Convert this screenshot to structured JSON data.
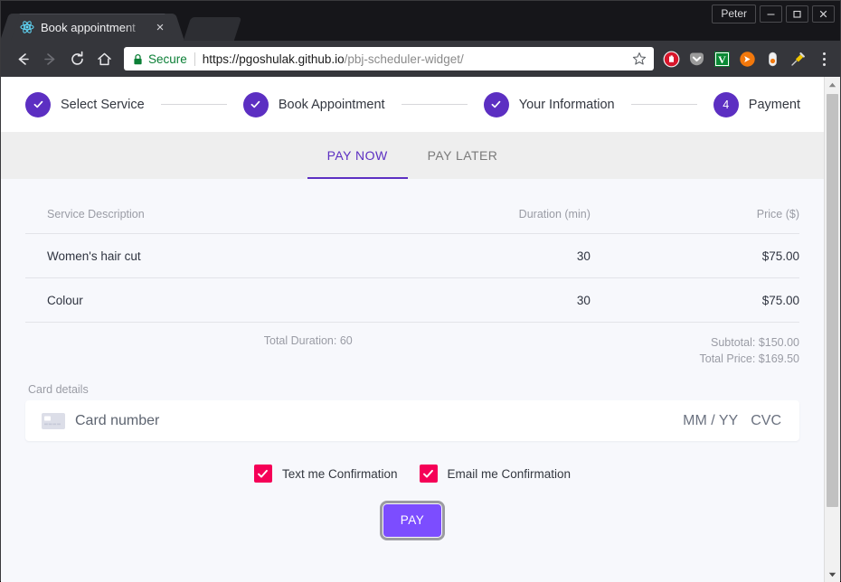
{
  "browser": {
    "window_user": "Peter",
    "minimize_label": "Minimize",
    "maximize_label": "Maximize",
    "close_label": "Close",
    "tab": {
      "title": "Book appointment",
      "favicon_name": "react-atom-favicon",
      "close_label": "×"
    },
    "new_tab_label": "New tab",
    "nav": {
      "back_label": "Back",
      "forward_label": "Forward",
      "reload_label": "Reload",
      "home_label": "Home"
    },
    "omnibox": {
      "security_text": "Secure",
      "url_domain": "https://pgoshulak.github.io",
      "url_path": "/pbj-scheduler-widget/",
      "bookmark_label": "Bookmark this page"
    },
    "extensions": [
      "adblock-icon",
      "pocket-icon",
      "vimeo-icon",
      "orange-arrow-icon",
      "capsule-icon",
      "syringe-icon"
    ],
    "menu_label": "Customize and control"
  },
  "colors": {
    "primary_purple": "#5c2fc2",
    "pay_button_purple": "#7c4dff",
    "checkbox_pink": "#f50057",
    "page_background": "#f7f8fc",
    "tab_bar_background": "#eeeeee"
  },
  "stepper": {
    "steps": [
      {
        "label": "Select Service",
        "state": "complete",
        "marker": "check-icon"
      },
      {
        "label": "Book Appointment",
        "state": "complete",
        "marker": "check-icon"
      },
      {
        "label": "Your Information",
        "state": "complete",
        "marker": "check-icon"
      },
      {
        "label": "Payment",
        "state": "active",
        "marker": "4"
      }
    ]
  },
  "pay_tabs": [
    {
      "label": "PAY NOW",
      "active": true
    },
    {
      "label": "PAY LATER",
      "active": false
    }
  ],
  "summary": {
    "columns": {
      "description": "Service Description",
      "duration": "Duration (min)",
      "price": "Price ($)"
    },
    "rows": [
      {
        "description": "Women's hair cut",
        "duration": "30",
        "price": "$75.00"
      },
      {
        "description": "Colour",
        "duration": "30",
        "price": "$75.00"
      }
    ],
    "total_duration": "Total Duration: 60",
    "subtotal": "Subtotal: $150.00",
    "total_price": "Total Price: $169.50"
  },
  "card": {
    "section_label": "Card details",
    "icon_name": "credit-card-icon",
    "number_placeholder": "Card number",
    "expiry_placeholder": "MM / YY",
    "cvc_placeholder": "CVC",
    "number_value": "",
    "expiry_value": "",
    "cvc_value": ""
  },
  "confirmations": [
    {
      "label": "Text me Confirmation",
      "checked": true
    },
    {
      "label": "Email me Confirmation",
      "checked": true
    }
  ],
  "pay_button": {
    "label": "PAY",
    "focused": true
  },
  "scrollbar": {
    "up_label": "Scroll up",
    "down_label": "Scroll down",
    "thumb_label": "Scroll thumb"
  }
}
